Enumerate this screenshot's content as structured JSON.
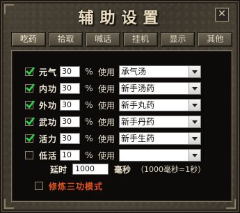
{
  "window": {
    "title": "辅助设置",
    "close_symbol": "✕"
  },
  "tabs": [
    {
      "label": "吃药"
    },
    {
      "label": "拾取"
    },
    {
      "label": "喊话"
    },
    {
      "label": "挂机"
    },
    {
      "label": "显示"
    },
    {
      "label": "其他"
    }
  ],
  "rows": [
    {
      "label": "元气",
      "checked": true,
      "value": "30",
      "percent_symbol": "%",
      "use_label": "使用",
      "selected": "承气汤"
    },
    {
      "label": "内功",
      "checked": true,
      "value": "30",
      "percent_symbol": "%",
      "use_label": "使用",
      "selected": "新手汤药"
    },
    {
      "label": "外功",
      "checked": true,
      "value": "30",
      "percent_symbol": "%",
      "use_label": "使用",
      "selected": "新手丸药"
    },
    {
      "label": "武功",
      "checked": true,
      "value": "30",
      "percent_symbol": "%",
      "use_label": "使用",
      "selected": "新手丹药"
    },
    {
      "label": "活力",
      "checked": true,
      "value": "30",
      "percent_symbol": "%",
      "use_label": "使用",
      "selected": "新手生药"
    },
    {
      "label": "低活",
      "checked": false,
      "value": "10",
      "percent_symbol": "%",
      "use_label": "使用",
      "selected": ""
    }
  ],
  "delay": {
    "label": "延时",
    "value": "1000",
    "unit": "毫秒",
    "note": "（1000毫秒=1秒）"
  },
  "cultivate": {
    "label": "修炼三功模式",
    "checked": false
  },
  "colors": {
    "check": "#27d84a",
    "accent_text": "#e0531c"
  }
}
